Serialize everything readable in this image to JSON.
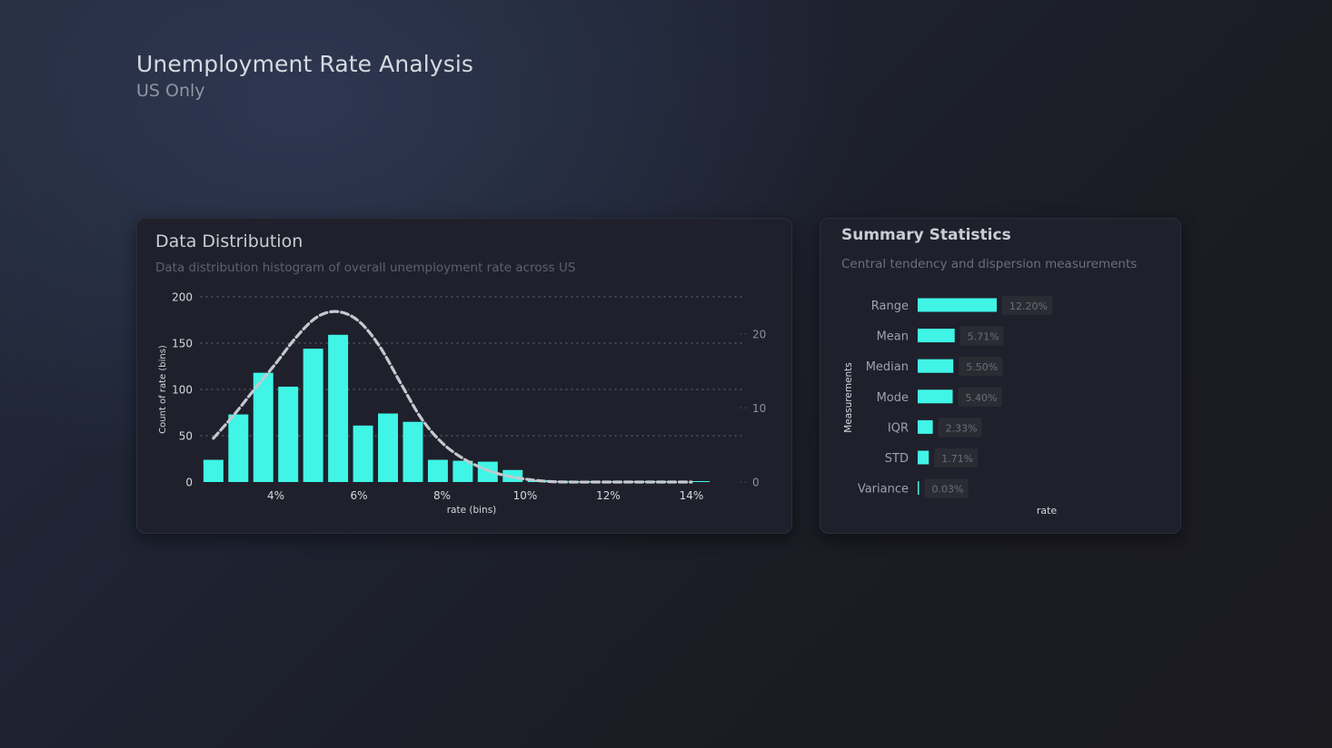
{
  "page": {
    "title": "Unemployment Rate Analysis",
    "subtitle": "US Only"
  },
  "distribution_card": {
    "title": "Data Distribution",
    "subtitle": "Data distribution histogram of overall unemployment rate across US"
  },
  "stats_card": {
    "title": "Summary Statistics",
    "subtitle": "Central tendency and dispersion measurements"
  },
  "colors": {
    "bar": "#40f5e6",
    "curve": "#c5c9cf",
    "axis_text": "#d6d9de",
    "gridline": "#5d6170",
    "value_label_bg": "#2b2c33",
    "value_label_text": "#6b6e78"
  },
  "chart_data": [
    {
      "type": "bar",
      "title": "",
      "xlabel": "rate (bins)",
      "ylabel": "Count of rate (bins)",
      "secondary_ylabel": "",
      "x_ticks": [
        "4%",
        "6%",
        "8%",
        "10%",
        "12%",
        "14%"
      ],
      "x_tick_values": [
        4,
        6,
        8,
        10,
        12,
        14
      ],
      "y_ticks": [
        0,
        50,
        100,
        150,
        200
      ],
      "y2_ticks": [
        0,
        10,
        20
      ],
      "ylim": [
        0,
        200
      ],
      "y2lim": [
        0,
        25
      ],
      "xlim": [
        2,
        15.5
      ],
      "grid": true,
      "bin_width": 0.6,
      "bins": [
        2.5,
        3.1,
        3.7,
        4.3,
        4.9,
        5.5,
        6.1,
        6.7,
        7.3,
        7.9,
        8.5,
        9.1,
        9.7,
        10.3,
        10.9,
        11.5,
        12.1,
        12.7,
        13.3,
        14.2
      ],
      "values": [
        24,
        73,
        118,
        103,
        144,
        159,
        61,
        74,
        65,
        24,
        23,
        22,
        13,
        2,
        1,
        1,
        1,
        1,
        1,
        1
      ],
      "series": [
        {
          "type": "line",
          "style": "dashed",
          "x": [
            2.5,
            3.0,
            3.5,
            4.0,
            4.5,
            5.0,
            5.5,
            6.0,
            6.5,
            7.0,
            7.5,
            8.0,
            8.5,
            9.0,
            9.5,
            10.0,
            10.5,
            11.0,
            12.0,
            13.0,
            14.0
          ],
          "y": [
            5.9,
            9.1,
            12.6,
            16.0,
            19.6,
            22.3,
            23.0,
            21.7,
            18.3,
            13.4,
            8.6,
            5.3,
            3.2,
            1.8,
            0.9,
            0.4,
            0.1,
            0.0,
            0.0,
            0.0,
            0.0
          ]
        }
      ]
    },
    {
      "type": "bar",
      "orientation": "horizontal",
      "title": "",
      "xlabel": "rate",
      "ylabel": "Measurements",
      "categories": [
        "Range",
        "Mean",
        "Median",
        "Mode",
        "IQR",
        "STD",
        "Variance"
      ],
      "values": [
        12.2,
        5.71,
        5.5,
        5.4,
        2.33,
        1.71,
        0.03
      ],
      "value_labels": [
        "12.20%",
        "5.71%",
        "5.50%",
        "5.40%",
        "2.33%",
        "1.71%",
        "0.03%"
      ],
      "xlim": [
        0,
        12.2
      ]
    }
  ]
}
